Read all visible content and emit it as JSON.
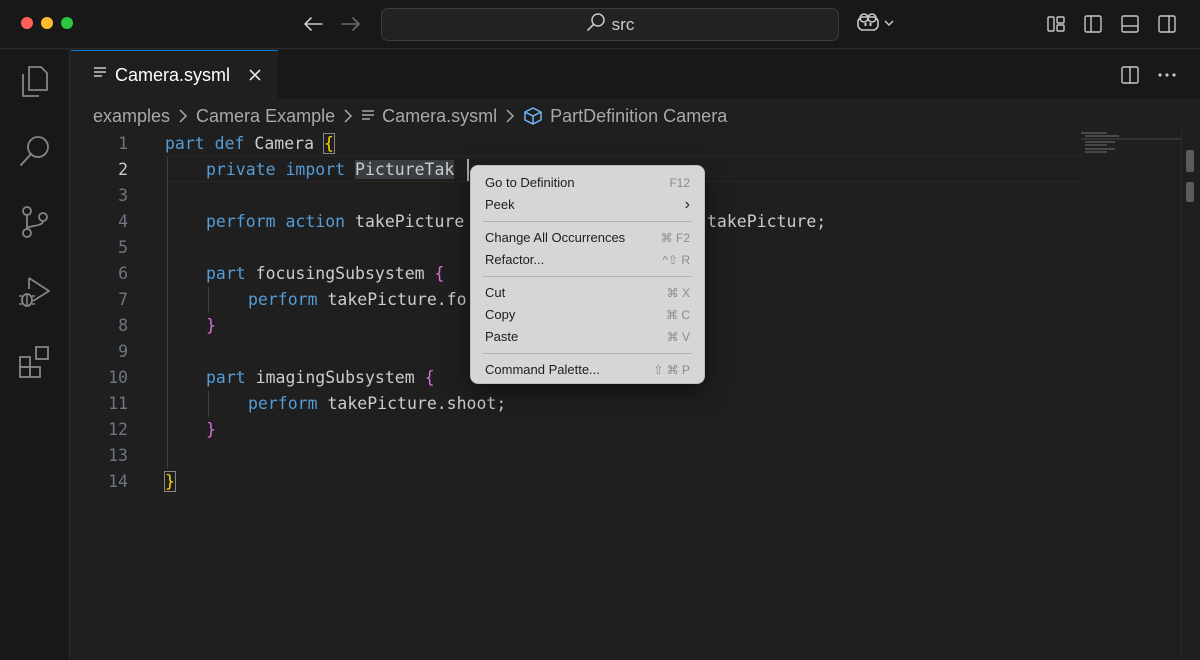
{
  "titlebar": {
    "search_text": "src"
  },
  "tab": {
    "label": "Camera.sysml"
  },
  "breadcrumb": {
    "items": [
      "examples",
      "Camera Example",
      "Camera.sysml",
      "PartDefinition Camera"
    ]
  },
  "editor": {
    "line_numbers": [
      "1",
      "2",
      "3",
      "4",
      "5",
      "6",
      "7",
      "8",
      "9",
      "10",
      "11",
      "12",
      "13",
      "14"
    ],
    "active_line": "2",
    "lines": {
      "l1": {
        "kw": "part def",
        "name": " Camera ",
        "brace": "{"
      },
      "l2": {
        "kw": "private import",
        "sp": " ",
        "sel": "PictureTak"
      },
      "l4": {
        "kw": "perform action",
        "mid": " takePicture",
        "tail": "takePicture;"
      },
      "l6": {
        "kw": "part",
        "name": " focusingSubsystem ",
        "brace": "{"
      },
      "l7": {
        "kw": "perform",
        "rest": " takePicture.fo"
      },
      "l8": {
        "brace": "}"
      },
      "l10": {
        "kw": "part",
        "name": " imagingSubsystem ",
        "brace": "{"
      },
      "l11": {
        "kw": "perform",
        "rest": " takePicture.shoot;"
      },
      "l12": {
        "brace": "}"
      },
      "l14": {
        "brace": "}"
      }
    }
  },
  "context_menu": {
    "groups": [
      [
        {
          "label": "Go to Definition",
          "shortcut": "F12"
        },
        {
          "label": "Peek",
          "shortcut": "›"
        }
      ],
      [
        {
          "label": "Change All Occurrences",
          "shortcut": "⌘ F2"
        },
        {
          "label": "Refactor...",
          "shortcut": "^⇧ R"
        }
      ],
      [
        {
          "label": "Cut",
          "shortcut": "⌘ X"
        },
        {
          "label": "Copy",
          "shortcut": "⌘ C"
        },
        {
          "label": "Paste",
          "shortcut": "⌘ V"
        }
      ],
      [
        {
          "label": "Command Palette...",
          "shortcut": "⇧ ⌘ P"
        }
      ]
    ]
  },
  "colors": {
    "keyword": "#569cd6",
    "bracket_outer": "#ffd700",
    "bracket_inner": "#da70d6",
    "accent": "#0078d4"
  },
  "icons": [
    "back-arrow-icon",
    "forward-arrow-icon",
    "search-icon",
    "copilot-icon",
    "layout-icon",
    "toggle-sidebar-icon",
    "toggle-panel-icon",
    "toggle-secondary-sidebar-icon",
    "explorer-icon",
    "search-view-icon",
    "source-control-icon",
    "run-debug-icon",
    "extensions-icon",
    "file-lines-icon",
    "close-icon",
    "split-editor-icon",
    "more-actions-icon",
    "chevron-right-icon",
    "symbol-class-icon"
  ]
}
